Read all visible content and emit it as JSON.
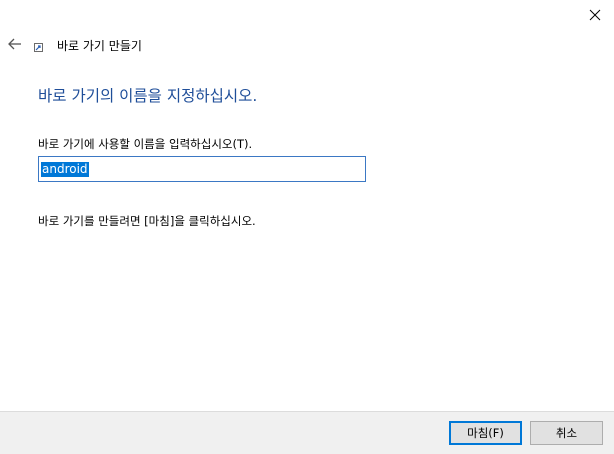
{
  "window": {
    "close_glyph": "✕"
  },
  "header": {
    "back_glyph": "←",
    "title": "바로 가기 만들기"
  },
  "main": {
    "heading": "바로 가기의 이름을 지정하십시오.",
    "field_label": "바로 가기에 사용할 이름을 입력하십시오(T).",
    "input_value": "android",
    "hint": "바로 가기를 만들려면 [마침]을 클릭하십시오."
  },
  "footer": {
    "finish_label": "마침(F)",
    "cancel_label": "취소"
  },
  "colors": {
    "accent": "#0078d7",
    "heading": "#1f4e99",
    "footer_bg": "#f0f0f0"
  },
  "icons": [
    "close-icon",
    "back-arrow-icon",
    "shortcut-icon"
  ]
}
